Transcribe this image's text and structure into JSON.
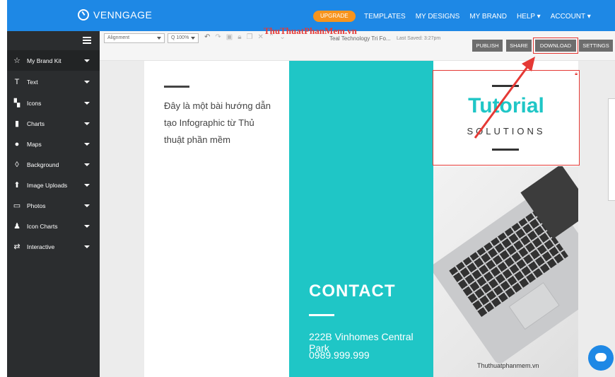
{
  "nav": {
    "brand": "VENNGAGE",
    "upgrade": "UPGRADE",
    "links": [
      "TEMPLATES",
      "MY DESIGNS",
      "MY BRAND",
      "HELP ▾",
      "ACCOUNT ▾"
    ]
  },
  "sidebar": {
    "items": [
      {
        "label": "My Brand Kit",
        "icon": "☆"
      },
      {
        "label": "Text",
        "icon": "T"
      },
      {
        "label": "Icons",
        "icon": "▚"
      },
      {
        "label": "Charts",
        "icon": "▮"
      },
      {
        "label": "Maps",
        "icon": "●"
      },
      {
        "label": "Background",
        "icon": "◊"
      },
      {
        "label": "Image Uploads",
        "icon": "⬆"
      },
      {
        "label": "Photos",
        "icon": "▭"
      },
      {
        "label": "Icon Charts",
        "icon": "♟"
      },
      {
        "label": "Interactive",
        "icon": "⇄"
      }
    ]
  },
  "toolbar": {
    "alignment": "Alignment",
    "zoom": "Q 100%",
    "doc_title": "Teal Technology Tri Fo...",
    "last_saved": "Last Saved: 3:27pm",
    "watermark": "ThuThuatPhanMem.vn",
    "publish": "PUBLISH",
    "share": "SHARE",
    "download": "DOWNLOAD",
    "settings": "SETTINGS"
  },
  "design": {
    "intro_text": "Đây là một bài hướng dẫn tạo Infographic từ Thủ thuật phần mềm",
    "tutorial_title": "Tutorial",
    "tutorial_sub": "SOLUTIONS",
    "contact_title": "CONTACT",
    "address": "222B Vinhomes Central Park",
    "phone": "0989.999.999",
    "photo_caption": "Thuthuatphanmem.vn"
  },
  "colors": {
    "nav_blue": "#1e88e5",
    "teal": "#1fc6c6",
    "upgrade_orange": "#f7941d",
    "highlight_red": "#e53935"
  }
}
